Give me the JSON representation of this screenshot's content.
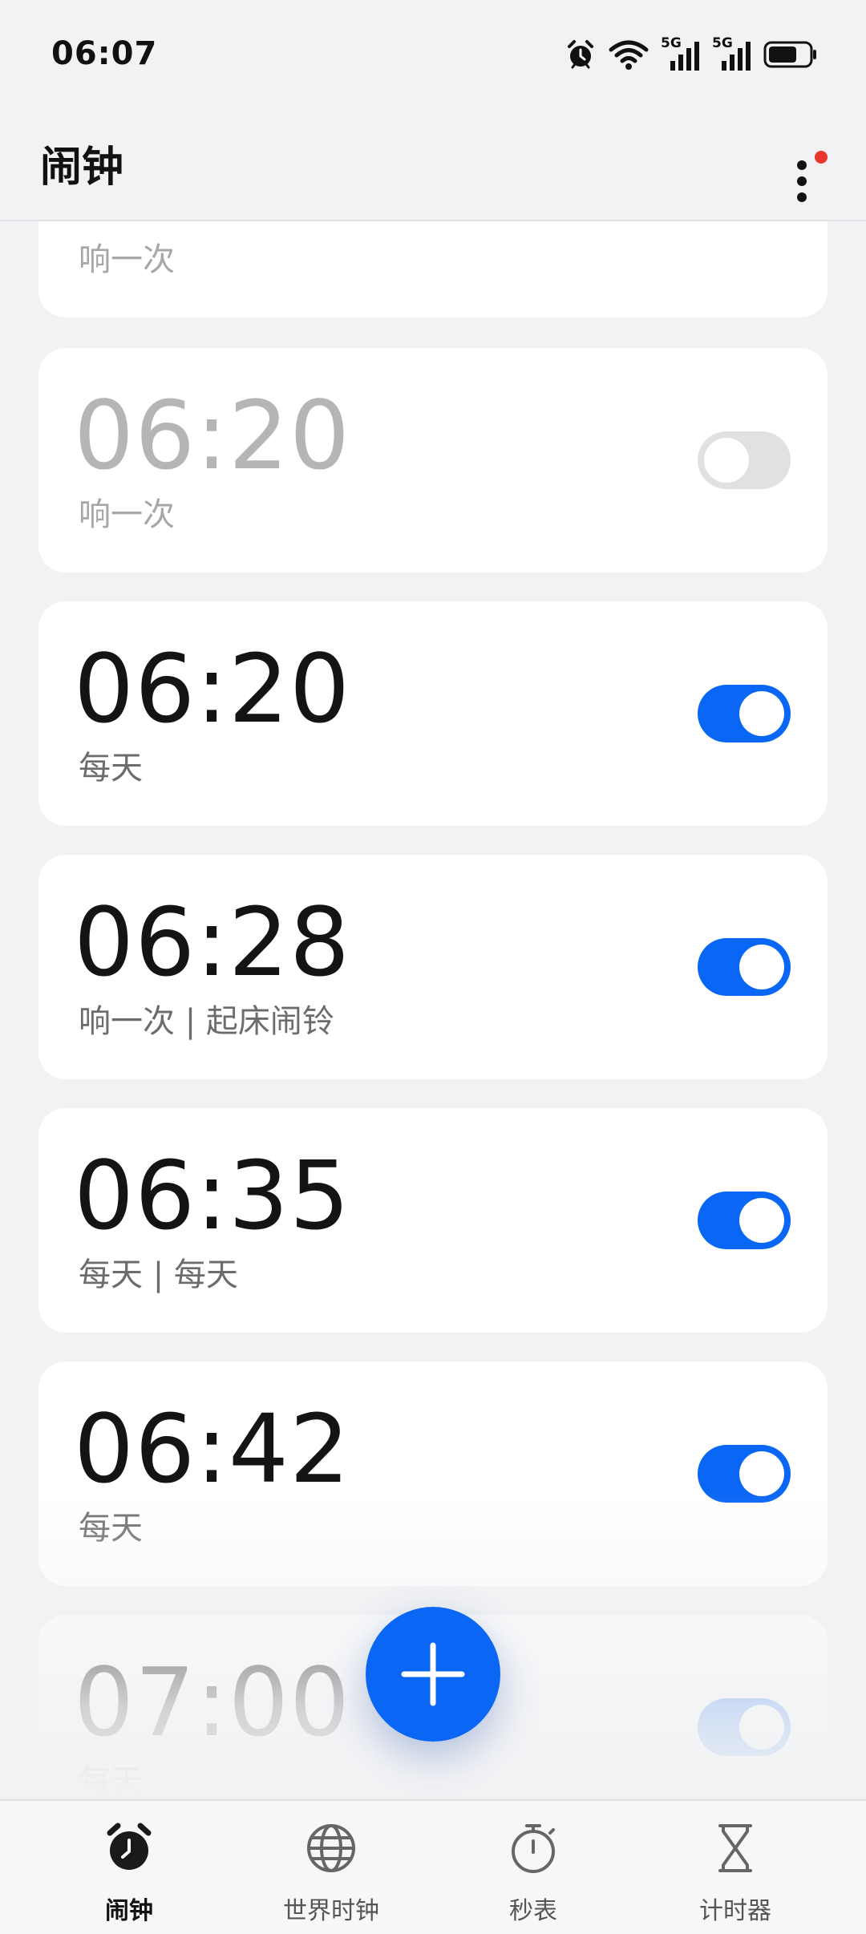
{
  "status_bar": {
    "time": "06:07",
    "icons": [
      "alarm-icon",
      "wifi-icon",
      "signal-5g-icon",
      "signal-5g-icon",
      "battery-icon"
    ],
    "network_label_1": "5G",
    "network_label_2": "5G"
  },
  "header": {
    "title": "闹钟",
    "more_icon": "more-vertical-icon",
    "has_badge": true
  },
  "alarms": [
    {
      "time": "",
      "desc": "响一次",
      "enabled": false
    },
    {
      "time": "06:20",
      "desc": "响一次",
      "enabled": false
    },
    {
      "time": "06:20",
      "desc": "每天",
      "enabled": true
    },
    {
      "time": "06:28",
      "desc": "响一次 | 起床闹铃",
      "enabled": true
    },
    {
      "time": "06:35",
      "desc": "每天 | 每天",
      "enabled": true
    },
    {
      "time": "06:42",
      "desc": "每天",
      "enabled": true
    },
    {
      "time": "07:00",
      "desc": "每天",
      "enabled": true
    }
  ],
  "fab": {
    "icon": "plus-icon"
  },
  "bottom_nav": {
    "items": [
      {
        "label": "闹钟",
        "icon": "alarm-clock-icon",
        "active": true
      },
      {
        "label": "世界时钟",
        "icon": "globe-icon",
        "active": false
      },
      {
        "label": "秒表",
        "icon": "stopwatch-icon",
        "active": false
      },
      {
        "label": "计时器",
        "icon": "hourglass-icon",
        "active": false
      }
    ]
  },
  "colors": {
    "accent": "#0a66f5",
    "background": "#f1f2f4",
    "card": "#ffffff",
    "badge": "#e8372d"
  }
}
